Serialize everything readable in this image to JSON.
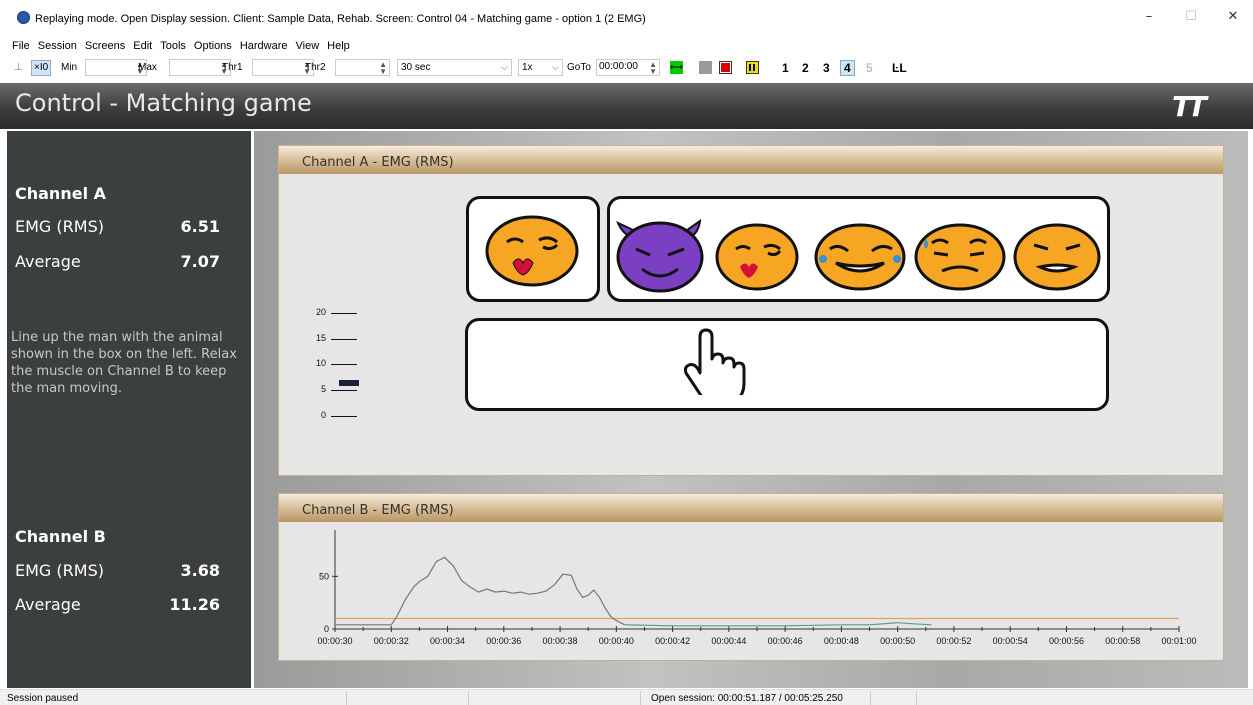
{
  "window": {
    "title": "Replaying mode. Open Display session. Client: Sample Data, Rehab. Screen: Control 04 - Matching game - option 1 (2 EMG)",
    "minimize": "–",
    "maximize": "☐",
    "close": "✕"
  },
  "menu": [
    "File",
    "Session",
    "Screens",
    "Edit",
    "Tools",
    "Options",
    "Hardware",
    "View",
    "Help"
  ],
  "toolbar": {
    "scale_label": "×I0",
    "min_label": "Min",
    "max_label": "Max",
    "thr1_label": "Thr1",
    "thr2_label": "Thr2",
    "timespan": "30 sec",
    "speed": "1x",
    "goto_label": "GoTo",
    "goto_value": "00:00:00",
    "screen_numbers": [
      "1",
      "2",
      "3",
      "4",
      "5"
    ],
    "active_screen": "4",
    "accent_green": "#00cc00",
    "stop_color": "#e00000",
    "pause_color": "#f0e000"
  },
  "header": {
    "title": "Control - Matching game",
    "logo": "TT"
  },
  "left": {
    "channel_a": {
      "title": "Channel A",
      "emg_label": "EMG (RMS)",
      "emg_value": "6.51",
      "avg_label": "Average",
      "avg_value": "7.07"
    },
    "instructions": "Line up the man with the animal shown in the box on the left. Relax the muscle on Channel B to keep the man moving.",
    "channel_b": {
      "title": "Channel B",
      "emg_label": "EMG (RMS)",
      "emg_value": "3.68",
      "avg_label": "Average",
      "avg_value": "11.26"
    }
  },
  "panel_a": {
    "title": "Channel A - EMG (RMS)",
    "gauge_ticks": [
      "20",
      "15",
      "10",
      "5",
      "0"
    ],
    "gauge_level": 6.5,
    "target_emoji": "kissing-face",
    "row_emojis": [
      "smiling-devil",
      "kissing-face",
      "laughing-tears",
      "worried-sweat",
      "expressionless"
    ],
    "pointer_icon": "hand-pointer"
  },
  "panel_b": {
    "title": "Channel B - EMG (RMS)"
  },
  "chart_data": {
    "type": "line",
    "title": "",
    "xlabel": "",
    "ylabel": "",
    "x_ticks": [
      "00:00:30",
      "00:00:32",
      "00:00:34",
      "00:00:36",
      "00:00:38",
      "00:00:40",
      "00:00:42",
      "00:00:44",
      "00:00:46",
      "00:00:48",
      "00:00:50",
      "00:00:52",
      "00:00:54",
      "00:00:56",
      "00:00:58",
      "00:01:00"
    ],
    "y_ticks": [
      "50",
      "0"
    ],
    "xlim": [
      30,
      60
    ],
    "ylim": [
      0,
      75
    ],
    "threshold": 10,
    "threshold_color": "#e8a060",
    "series": [
      {
        "color": "#777777",
        "x": [
          30,
          31,
          32,
          32.2,
          32.5,
          32.8,
          33,
          33.3,
          33.6,
          33.9,
          34.2,
          34.5,
          34.8,
          35.1,
          35.4,
          35.7,
          36,
          36.3,
          36.6,
          36.9,
          37.2,
          37.5,
          37.8,
          38.1,
          38.4,
          38.6,
          38.8,
          39,
          39.2,
          39.4,
          39.6,
          39.8,
          40,
          40.3
        ],
        "values": [
          4,
          4,
          4,
          12,
          28,
          40,
          45,
          50,
          64,
          68,
          60,
          46,
          40,
          35,
          38,
          35,
          36,
          34,
          35,
          33,
          34,
          36,
          42,
          52,
          51,
          38,
          30,
          32,
          37,
          30,
          20,
          12,
          8,
          4
        ]
      },
      {
        "color": "#5a9a9a",
        "x": [
          40.3,
          42,
          44,
          46,
          48,
          49,
          50,
          50.5,
          51.2
        ],
        "values": [
          4,
          3,
          3,
          3,
          4,
          4,
          6,
          5,
          4
        ]
      }
    ]
  },
  "status": {
    "left": "Session paused",
    "session": "Open session: 00:00:51.187 / 00:05:25.250"
  }
}
